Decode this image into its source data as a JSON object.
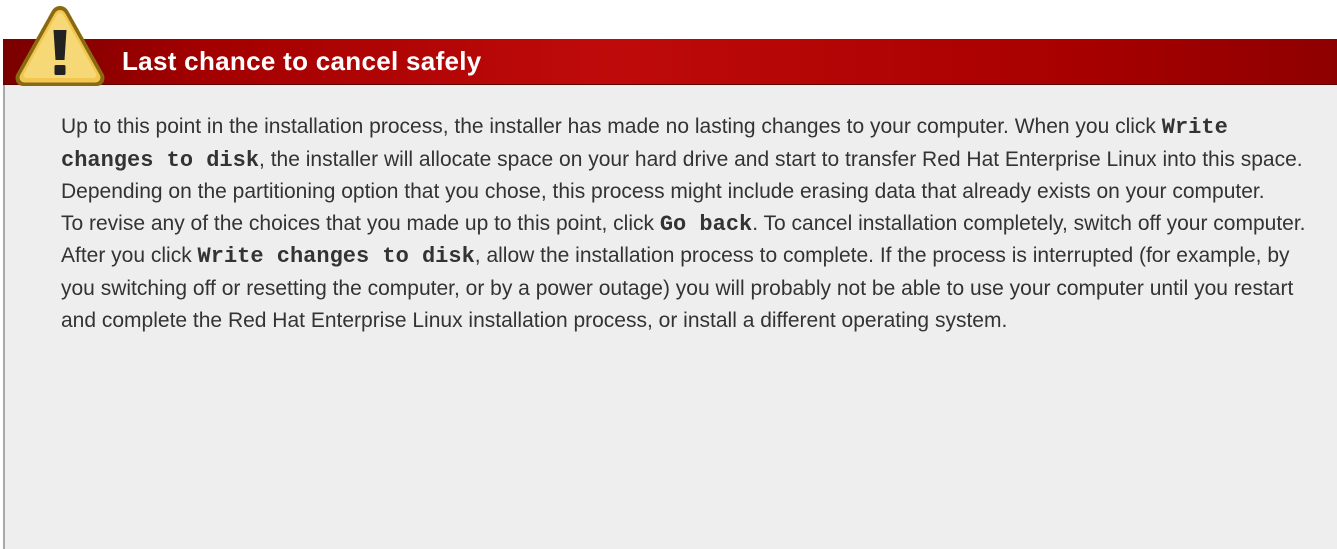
{
  "admonition": {
    "type": "warning",
    "icon": "warning-icon",
    "colors": {
      "header": "#a30000",
      "title_text": "#ffffff",
      "body_background": "#eeeeee",
      "body_text": "#333333",
      "icon_fill": "#f0c34f",
      "icon_outline": "#8a6a10"
    },
    "title": "Last chance to cancel safely",
    "paragraphs": [
      {
        "segments": [
          "Up to this point in the installation process, the installer has made no lasting changes to your computer. When you click ",
          "Write changes to disk",
          ", the installer will allocate space on your hard drive and start to transfer Red Hat Enterprise Linux into this space. Depending on the partitioning option that you chose, this process might include erasing data that already exists on your computer."
        ]
      },
      {
        "segments": [
          "To revise any of the choices that you made up to this point, click ",
          "Go back",
          ". To cancel installation completely, switch off your computer."
        ]
      },
      {
        "segments": [
          "After you click ",
          "Write changes to disk",
          ", allow the installation process to complete. If the process is interrupted (for example, by you switching off or resetting the computer, or by a power outage) you will probably not be able to use your computer until you restart and complete the Red Hat Enterprise Linux installation process, or install a different operating system."
        ]
      }
    ]
  }
}
